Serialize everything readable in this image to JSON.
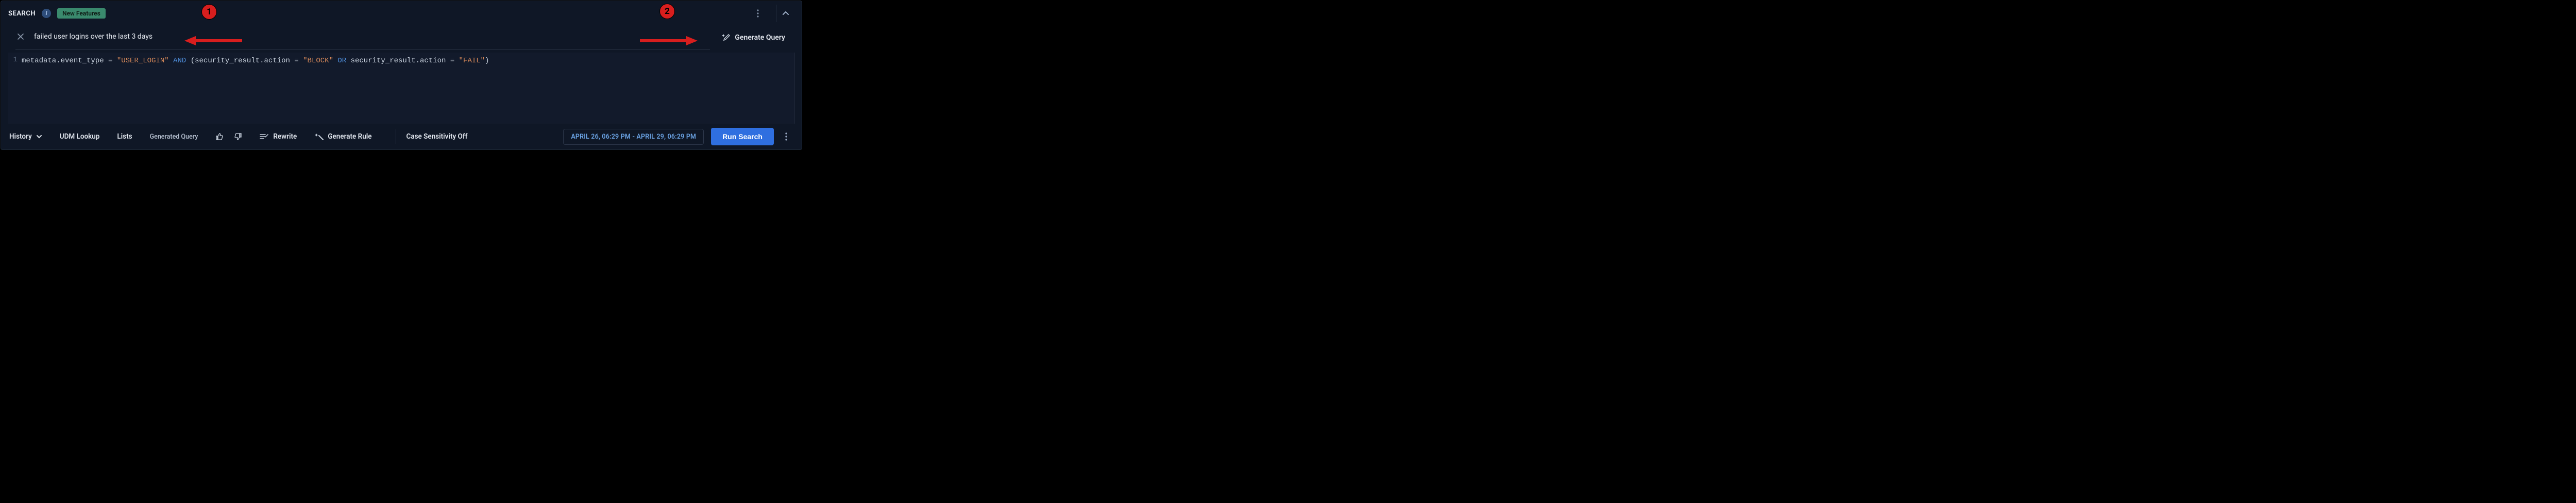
{
  "header": {
    "title": "SEARCH",
    "new_features_label": "New Features"
  },
  "nl_query": {
    "text": "failed user logins over the last 3 days",
    "generate_label": "Generate Query"
  },
  "editor": {
    "line_number": "1",
    "tokens": [
      {
        "cls": "tok-field",
        "t": "metadata.event_type "
      },
      {
        "cls": "tok-op",
        "t": "= "
      },
      {
        "cls": "tok-string",
        "t": "\"USER_LOGIN\""
      },
      {
        "cls": "tok-op",
        "t": " "
      },
      {
        "cls": "tok-kw",
        "t": "AND"
      },
      {
        "cls": "tok-op",
        "t": " ("
      },
      {
        "cls": "tok-field",
        "t": "security_result.action "
      },
      {
        "cls": "tok-op",
        "t": "= "
      },
      {
        "cls": "tok-string",
        "t": "\"BLOCK\""
      },
      {
        "cls": "tok-op",
        "t": " "
      },
      {
        "cls": "tok-kw",
        "t": "OR"
      },
      {
        "cls": "tok-op",
        "t": " "
      },
      {
        "cls": "tok-field",
        "t": "security_result.action "
      },
      {
        "cls": "tok-op",
        "t": "= "
      },
      {
        "cls": "tok-string",
        "t": "\"FAIL\""
      },
      {
        "cls": "tok-op",
        "t": ")"
      }
    ]
  },
  "toolbar": {
    "history": "History",
    "udm_lookup": "UDM Lookup",
    "lists": "Lists",
    "generated_query": "Generated Query",
    "rewrite": "Rewrite",
    "generate_rule": "Generate Rule",
    "case_sensitivity": "Case Sensitivity Off",
    "date_range": "APRIL 26, 06:29 PM - APRIL 29, 06:29 PM",
    "run_search": "Run Search"
  },
  "annotations": {
    "badge1": "1",
    "badge2": "2"
  }
}
